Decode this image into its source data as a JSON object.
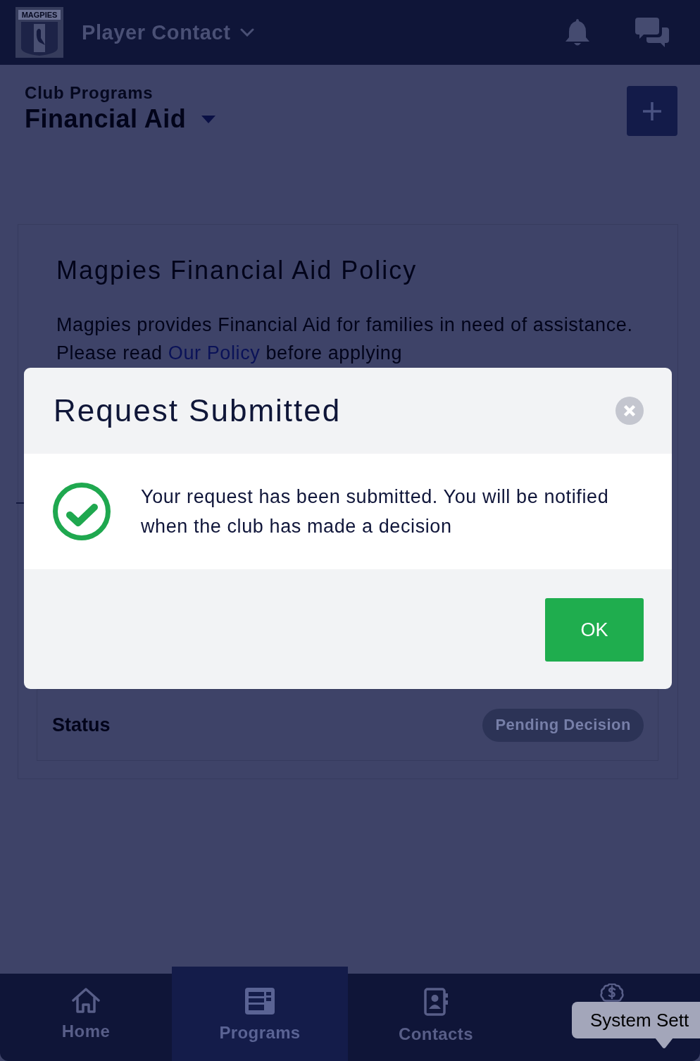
{
  "header": {
    "logo_text": "MAGPIES",
    "title": "Player Contact"
  },
  "page_header": {
    "section": "Club Programs",
    "title": "Financial Aid"
  },
  "policy": {
    "title": "Magpies Financial Aid Policy",
    "text_before_link": "Magpies provides Financial Aid for families in need of assistance. Please read",
    "link": "Our Policy",
    "text_after_link": "before applying"
  },
  "status": {
    "label": "Status",
    "value": "Pending Decision"
  },
  "dialog": {
    "title": "Request Submitted",
    "message": "Your request has been submitted. You will be notified when the club has made a decision",
    "buttons": [
      "OK"
    ]
  },
  "bottom_nav": [
    {
      "kind": "home",
      "label": "Home",
      "selected": false
    },
    {
      "kind": "programs",
      "label": "Programs",
      "selected": true
    },
    {
      "kind": "contacts",
      "label": "Contacts",
      "selected": false
    },
    {
      "kind": "money",
      "selected": false
    }
  ],
  "tooltip": {
    "text": "System Sett"
  }
}
